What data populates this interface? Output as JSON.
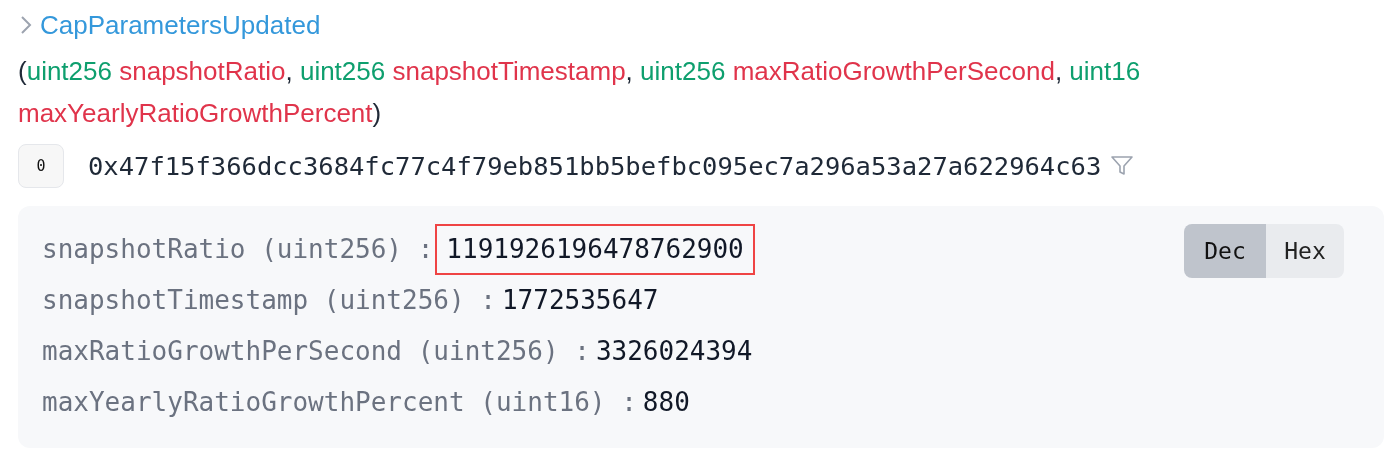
{
  "event": {
    "name": "CapParametersUpdated",
    "expanded": true,
    "signature": [
      {
        "kind": "punct",
        "text": "("
      },
      {
        "kind": "type",
        "text": "uint256"
      },
      {
        "kind": "name",
        "text": "snapshotRatio"
      },
      {
        "kind": "punct",
        "text": ","
      },
      {
        "kind": "type",
        "text": "uint256"
      },
      {
        "kind": "name",
        "text": "snapshotTimestamp"
      },
      {
        "kind": "punct",
        "text": ","
      },
      {
        "kind": "type",
        "text": "uint256"
      },
      {
        "kind": "name",
        "text": "maxRatioGrowthPerSecond"
      },
      {
        "kind": "punct",
        "text": ","
      },
      {
        "kind": "type",
        "text": "uint16"
      },
      {
        "kind": "name",
        "text": "maxYearlyRatioGrowthPercent"
      },
      {
        "kind": "punct",
        "text": ")"
      }
    ]
  },
  "topics": [
    {
      "index": "0",
      "value": "0x47f15f366dcc3684fc77c4f79eb851bb5befbc095ec7a296a53a27a622964c63"
    }
  ],
  "decoded": {
    "format_buttons": [
      {
        "label": "Dec",
        "selected": true
      },
      {
        "label": "Hex",
        "selected": false
      }
    ],
    "rows": [
      {
        "label": "snapshotRatio (uint256) :",
        "value": "1191926196478762900",
        "highlighted": true
      },
      {
        "label": "snapshotTimestamp (uint256) :",
        "value": "1772535647",
        "highlighted": false
      },
      {
        "label": "maxRatioGrowthPerSecond (uint256) :",
        "value": "3326024394",
        "highlighted": false
      },
      {
        "label": "maxYearlyRatioGrowthPercent (uint16) :",
        "value": "880",
        "highlighted": false
      }
    ]
  }
}
